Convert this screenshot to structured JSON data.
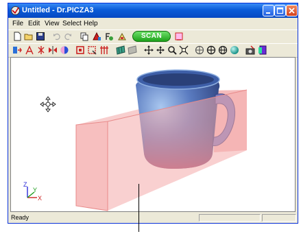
{
  "window": {
    "title": "Untitled - Dr.PICZA3"
  },
  "menu": [
    "File",
    "Edit",
    "View",
    "Select",
    "Help"
  ],
  "toolbar1": {
    "scan_label": "SCAN",
    "icons": [
      "new-icon",
      "open-icon",
      "save-icon",
      "undo-icon",
      "redo-icon",
      "copy-icon",
      "paste-icon",
      "settings-icon",
      "import-icon",
      "scan-button",
      "stop-icon"
    ]
  },
  "toolbar2": {
    "icons": [
      "select-icon",
      "trim-icon",
      "mirror-icon",
      "flip-icon",
      "smooth-icon",
      "box-select-icon",
      "zoom-area-icon",
      "fit-icon",
      "surface-icon",
      "wire-icon",
      "move-icon",
      "pan-icon",
      "zoom-icon",
      "zoom-fit-icon",
      "rotate-x-icon",
      "rotate-y-icon",
      "rotate-z-icon",
      "sphere-icon",
      "camera-icon",
      "color-icon"
    ]
  },
  "viewport": {
    "axes": {
      "z": "Z",
      "y": "Y",
      "x": "X"
    }
  },
  "status": {
    "text": "Ready"
  },
  "colors": {
    "mug": "#5a7bc0",
    "box": "#f4a9a9",
    "titlebar": "#0a5bd8",
    "scan": "#2db82a"
  }
}
